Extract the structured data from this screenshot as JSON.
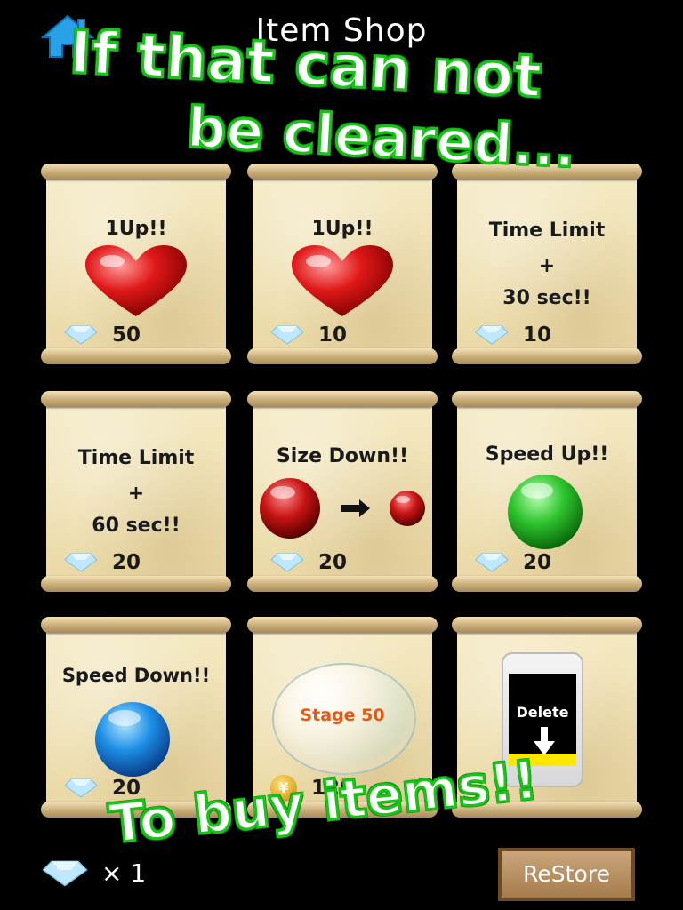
{
  "header": {
    "title": "Item Shop"
  },
  "items": [
    {
      "label_lines": [
        "1Up!!"
      ],
      "price": "50",
      "currency": "diamond-icon",
      "art": "heart"
    },
    {
      "label_lines": [
        "1Up!!"
      ],
      "price": "10",
      "currency": "diamond-icon",
      "art": "heart"
    },
    {
      "label_lines": [
        "Time Limit",
        "+",
        "30 sec!!"
      ],
      "price": "10",
      "currency": "diamond-icon",
      "art": "none"
    },
    {
      "label_lines": [
        "Time Limit",
        "+",
        "60 sec!!"
      ],
      "price": "20",
      "currency": "diamond-icon",
      "art": "none"
    },
    {
      "label_lines": [
        "Size Down!!"
      ],
      "price": "20",
      "currency": "diamond-icon",
      "art": "red-balls"
    },
    {
      "label_lines": [
        "Speed Up!!"
      ],
      "price": "20",
      "currency": "diamond-icon",
      "art": "green-ball"
    },
    {
      "label_lines": [
        "Speed Down!!"
      ],
      "price": "20",
      "currency": "diamond-icon",
      "art": "blue-ball"
    },
    {
      "label_lines": [],
      "bubble_text": "Stage 50",
      "price": "120",
      "currency": "yen-coin-icon",
      "art": "bubble"
    },
    {
      "label_lines": [],
      "phone_text": "Delete",
      "price": "",
      "currency": "",
      "art": "phone"
    }
  ],
  "overlay": {
    "line1": "If that can not",
    "line2": "be cleared...",
    "line3": "To buy items!!"
  },
  "footer": {
    "gem_count": "× 1",
    "restore_label": "ReStore"
  },
  "colors": {
    "background": "#000000",
    "overlay_outline": "#19c419",
    "home_icon": "#2aa0e6"
  }
}
